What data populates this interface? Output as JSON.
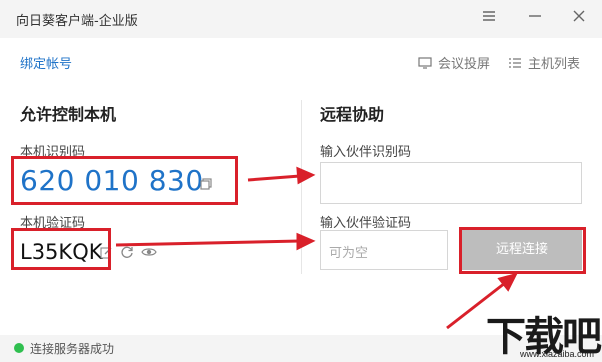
{
  "window": {
    "title": "向日葵客户端-企业版"
  },
  "toolbar": {
    "bind_account": "绑定帐号",
    "meeting_cast": "会议投屏",
    "host_list": "主机列表"
  },
  "left": {
    "heading": "允许控制本机",
    "id_label": "本机识别码",
    "id_value": "620 010 830",
    "pwd_label": "本机验证码",
    "pwd_value": "L35KQK"
  },
  "right": {
    "heading": "远程协助",
    "partner_id_label": "输入伙伴识别码",
    "partner_pwd_label": "输入伙伴验证码",
    "partner_pwd_placeholder": "可为空",
    "connect_label": "远程连接"
  },
  "status": {
    "text": "连接服务器成功",
    "color": "#2fbf4f"
  },
  "watermark": {
    "text": "下载吧",
    "url": "www.xiazaiba.com"
  },
  "colors": {
    "accent": "#1f73c8",
    "annotation": "#d9202a",
    "button_disabled": "#bdbdbd"
  }
}
